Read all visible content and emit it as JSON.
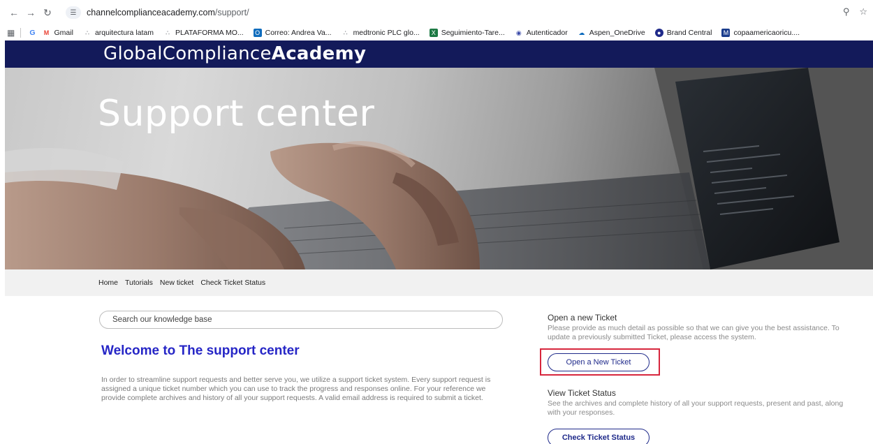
{
  "browser": {
    "url_host": "channelcomplianceacademy.com",
    "url_path": "/support/",
    "bookmarks": [
      "Gmail",
      "arquitectura latam",
      "PLATAFORMA MO...",
      "Correo: Andrea Va...",
      "medtronic PLC glo...",
      "Seguimiento-Tare...",
      "Autenticador",
      "Aspen_OneDrive",
      "Brand Central",
      "copaamericaoricu...."
    ]
  },
  "header": {
    "logo_regular": "GlobalCompliance",
    "logo_bold": "Academy"
  },
  "hero": {
    "title": "Support center"
  },
  "subnav": [
    "Home",
    "Tutorials",
    "New ticket",
    "Check Ticket Status"
  ],
  "search": {
    "placeholder": "Search our knowledge base"
  },
  "main": {
    "welcome": "Welcome to  The support center",
    "intro": "In order to streamline support requests and better serve you, we utilize a support ticket system. Every support request is assigned a unique ticket number which you can use to track the progress and responses online. For your reference we provide complete archives and history of all your support requests. A valid email address is required to submit a ticket."
  },
  "sidebar": {
    "new_ticket": {
      "heading": "Open a new Ticket",
      "text": "Please provide as much detail as possible so that we can give you the best assistance. To update a previously submitted Ticket, please access the system.",
      "button": "Open a New Ticket"
    },
    "status": {
      "heading": "View Ticket Status",
      "text": "See the archives and complete history of all your support requests, present and past, along with your responses.",
      "button": "Check Ticket Status"
    }
  },
  "colors": {
    "header_bg": "#131a5a",
    "accent_blue": "#2626c6",
    "highlight_red": "#d7263d"
  }
}
